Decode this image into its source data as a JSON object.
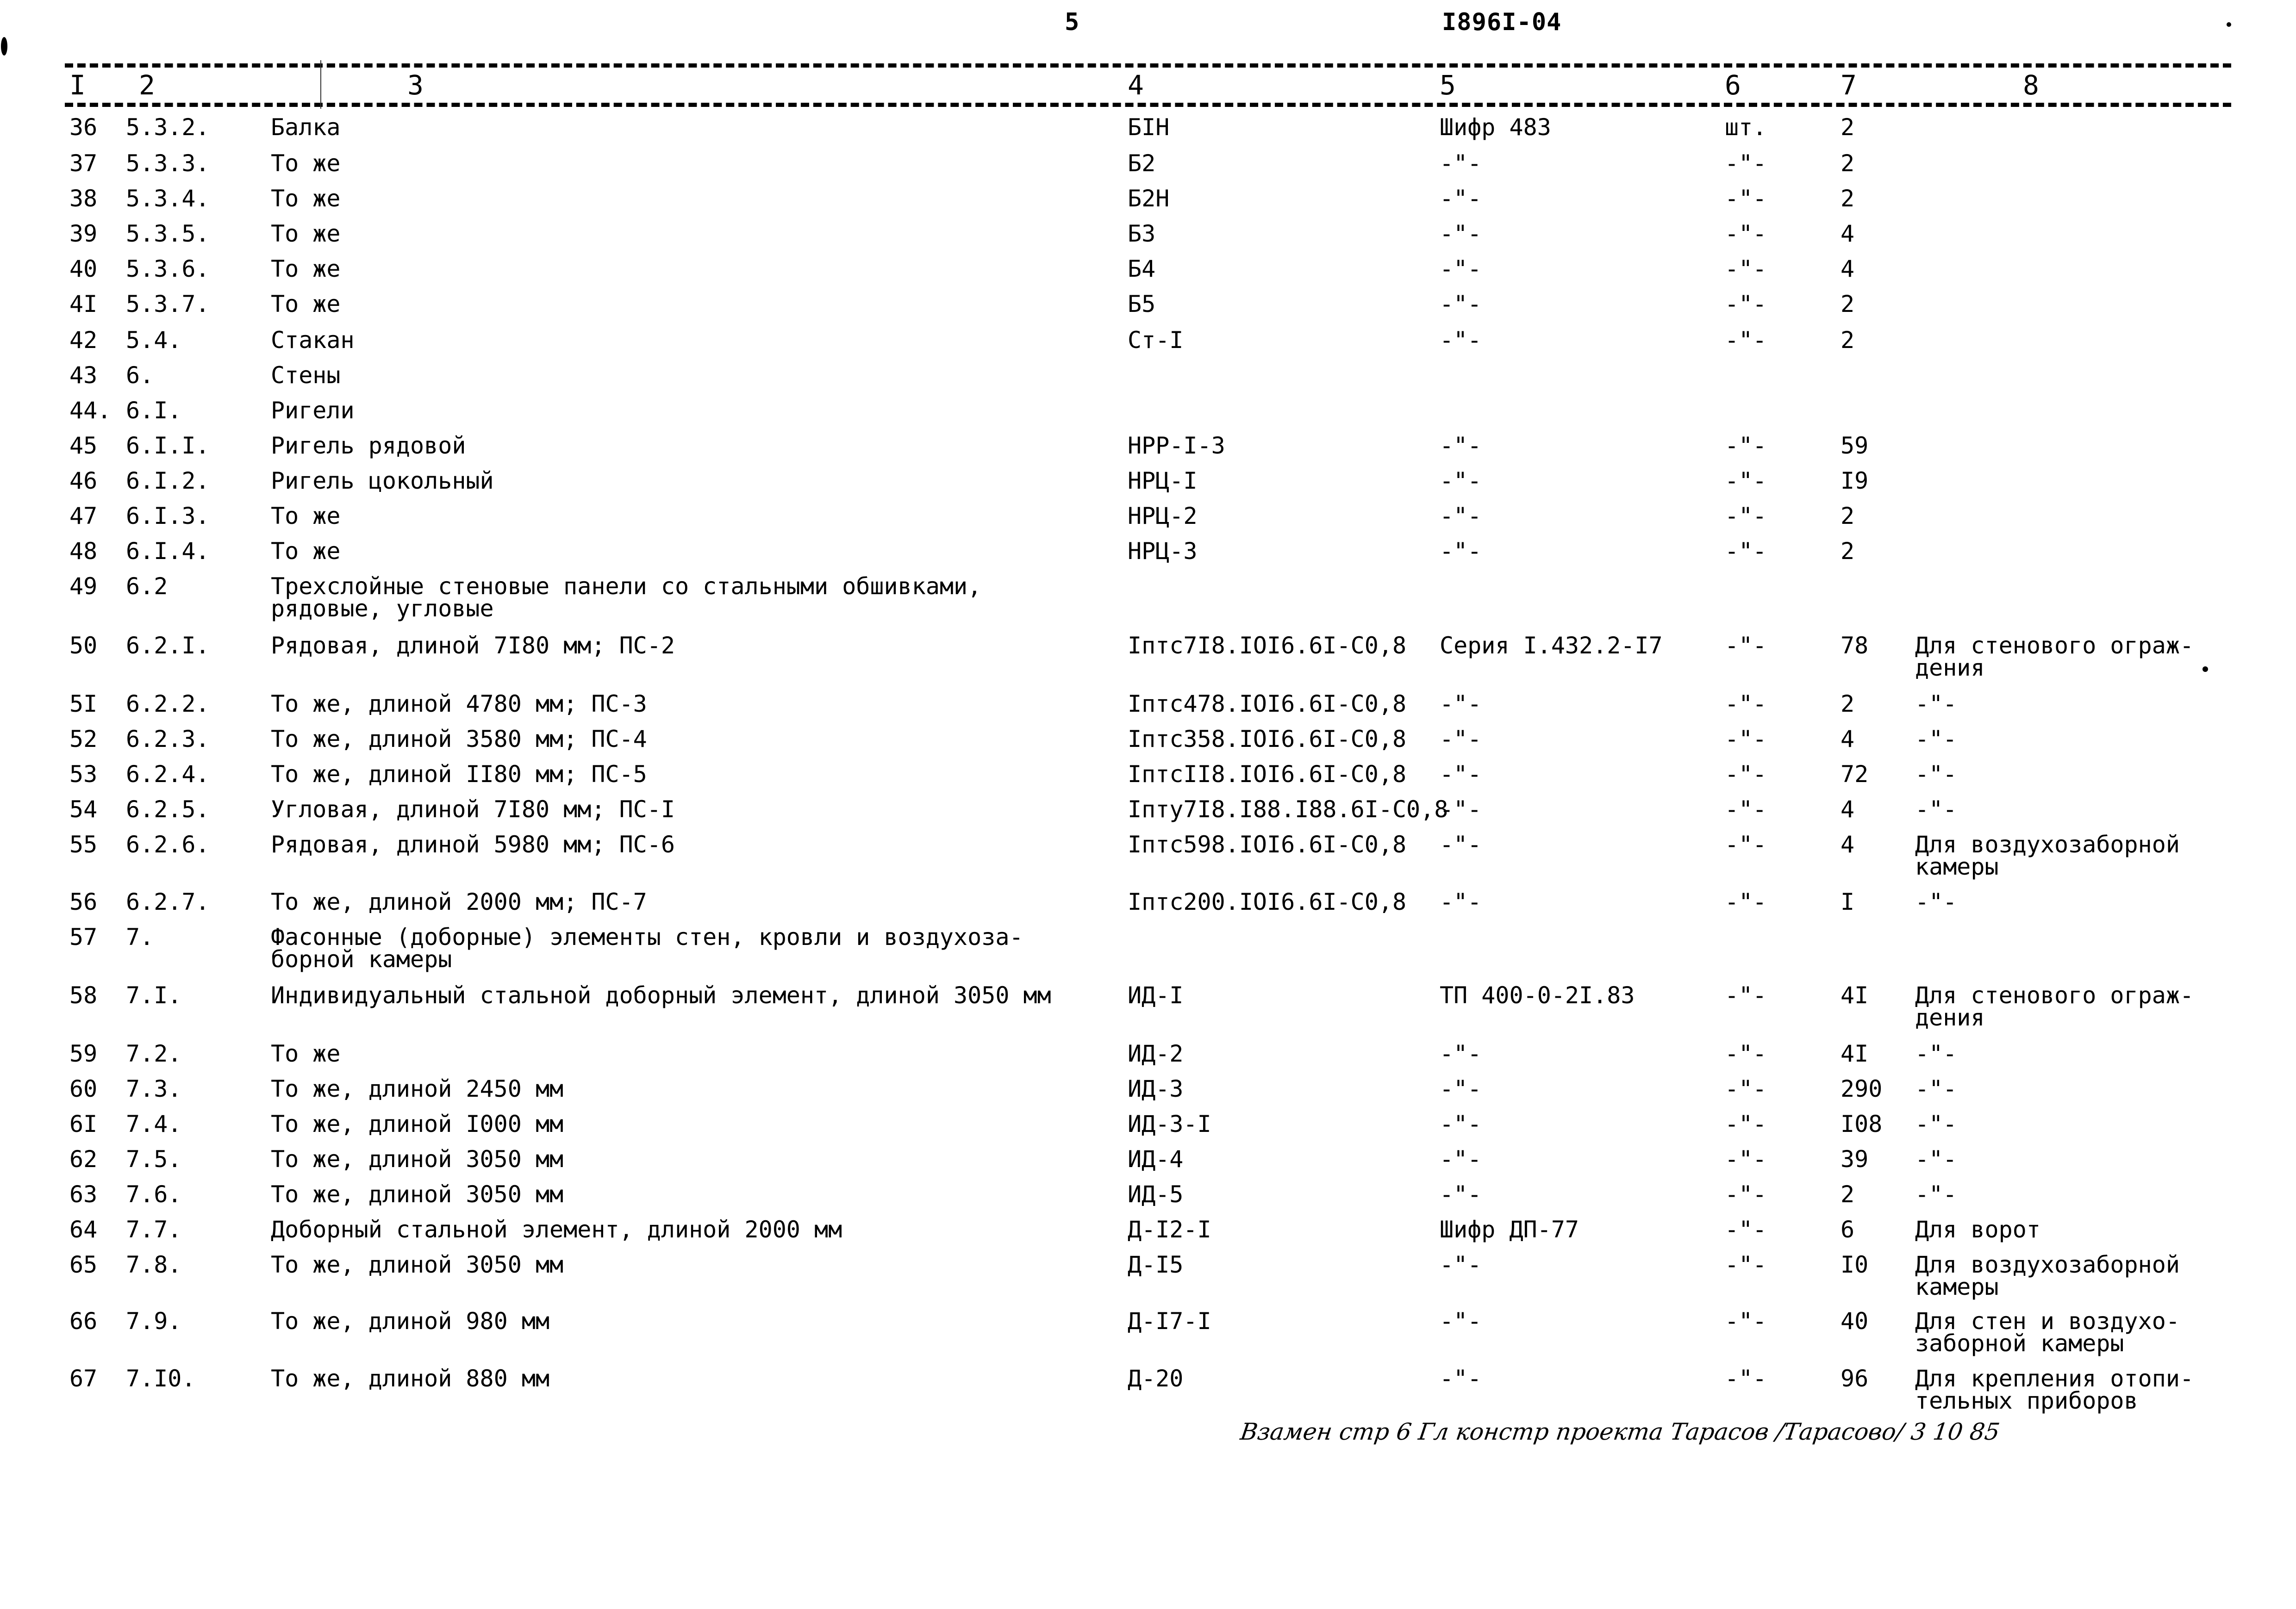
{
  "header": {
    "page_mark": "5",
    "doc_code": "I896I-04"
  },
  "columns": [
    "I",
    "2",
    "3",
    "4",
    "5",
    "6",
    "7",
    "8"
  ],
  "rows": [
    {
      "n": "36",
      "pos": "5.3.2.",
      "name": [
        "Балка"
      ],
      "mark": "БIН",
      "doc": "Шифр 483",
      "unit": "шт.",
      "qty": "2",
      "note": []
    },
    {
      "n": "37",
      "pos": "5.3.3.",
      "name": [
        "То же"
      ],
      "mark": "Б2",
      "doc": "-\"-",
      "unit": "-\"-",
      "qty": "2",
      "note": []
    },
    {
      "n": "38",
      "pos": "5.3.4.",
      "name": [
        "То же"
      ],
      "mark": "Б2Н",
      "doc": "-\"-",
      "unit": "-\"-",
      "qty": "2",
      "note": []
    },
    {
      "n": "39",
      "pos": "5.3.5.",
      "name": [
        "То же"
      ],
      "mark": "Б3",
      "doc": "-\"-",
      "unit": "-\"-",
      "qty": "4",
      "note": []
    },
    {
      "n": "40",
      "pos": "5.3.6.",
      "name": [
        "То же"
      ],
      "mark": "Б4",
      "doc": "-\"-",
      "unit": "-\"-",
      "qty": "4",
      "note": []
    },
    {
      "n": "4I",
      "pos": "5.3.7.",
      "name": [
        "То же"
      ],
      "mark": "Б5",
      "doc": "-\"-",
      "unit": "-\"-",
      "qty": "2",
      "note": []
    },
    {
      "n": "42",
      "pos": "5.4.",
      "name": [
        "Стакан"
      ],
      "mark": "Ст-I",
      "doc": "-\"-",
      "unit": "-\"-",
      "qty": "2",
      "note": []
    },
    {
      "n": "43",
      "pos": "6.",
      "name": [
        "Стены"
      ],
      "mark": "",
      "doc": "",
      "unit": "",
      "qty": "",
      "note": []
    },
    {
      "n": "44.",
      "pos": "6.I.",
      "name": [
        "Ригели"
      ],
      "mark": "",
      "doc": "",
      "unit": "",
      "qty": "",
      "note": []
    },
    {
      "n": "45",
      "pos": "6.I.I.",
      "name": [
        "Ригель рядовой"
      ],
      "mark": "НРР-I-3",
      "doc": "-\"-",
      "unit": "-\"-",
      "qty": "59",
      "note": []
    },
    {
      "n": "46",
      "pos": "6.I.2.",
      "name": [
        "Ригель цокольный"
      ],
      "mark": "НРЦ-I",
      "doc": "-\"-",
      "unit": "-\"-",
      "qty": "I9",
      "note": []
    },
    {
      "n": "47",
      "pos": "6.I.3.",
      "name": [
        "То же"
      ],
      "mark": "НРЦ-2",
      "doc": "-\"-",
      "unit": "-\"-",
      "qty": "2",
      "note": []
    },
    {
      "n": "48",
      "pos": "6.I.4.",
      "name": [
        "То же"
      ],
      "mark": "НРЦ-3",
      "doc": "-\"-",
      "unit": "-\"-",
      "qty": "2",
      "note": []
    },
    {
      "n": "49",
      "pos": "6.2",
      "name": [
        "Трехслойные стеновые панели со стальными обшивками,",
        "рядовые, угловые"
      ],
      "mark": "",
      "doc": "",
      "unit": "",
      "qty": "",
      "note": []
    },
    {
      "n": "50",
      "pos": "6.2.I.",
      "name": [
        "Рядовая, длиной 7I80 мм; ПС-2"
      ],
      "mark": "Iптс7I8.IOI6.6I-C0,8",
      "doc": "Серия I.432.2-I7",
      "unit": "-\"-",
      "qty": "78",
      "note": [
        "Для стенового ограж-",
        "дения"
      ]
    },
    {
      "n": "5I",
      "pos": "6.2.2.",
      "name": [
        "То же, длиной 4780 мм; ПС-3"
      ],
      "mark": "Iптс478.IOI6.6I-C0,8",
      "doc": "-\"-",
      "unit": "-\"-",
      "qty": "2",
      "note": [
        "-\"-"
      ]
    },
    {
      "n": "52",
      "pos": "6.2.3.",
      "name": [
        "То же, длиной 3580 мм; ПС-4"
      ],
      "mark": "Iптс358.IOI6.6I-C0,8",
      "doc": "-\"-",
      "unit": "-\"-",
      "qty": "4",
      "note": [
        "-\"-"
      ]
    },
    {
      "n": "53",
      "pos": "6.2.4.",
      "name": [
        "То же, длиной II80 мм; ПС-5"
      ],
      "mark": "IптсII8.IOI6.6I-C0,8",
      "doc": "-\"-",
      "unit": "-\"-",
      "qty": "72",
      "note": [
        "-\"-"
      ]
    },
    {
      "n": "54",
      "pos": "6.2.5.",
      "name": [
        "Угловая, длиной 7I80 мм; ПС-I"
      ],
      "mark": "Iпту7I8.I88.I88.6I-C0,8",
      "doc": "-\"-",
      "unit": "-\"-",
      "qty": "4",
      "note": [
        "-\"-"
      ]
    },
    {
      "n": "55",
      "pos": "6.2.6.",
      "name": [
        "Рядовая, длиной 5980 мм; ПС-6"
      ],
      "mark": "Iптс598.IOI6.6I-C0,8",
      "doc": "-\"-",
      "unit": "-\"-",
      "qty": "4",
      "note": [
        "Для воздухозаборной",
        "камеры"
      ]
    },
    {
      "n": "56",
      "pos": "6.2.7.",
      "name": [
        "То же, длиной 2000 мм; ПС-7"
      ],
      "mark": "Iптс200.IOI6.6I-C0,8",
      "doc": "-\"-",
      "unit": "-\"-",
      "qty": "I",
      "note": [
        "-\"-"
      ]
    },
    {
      "n": "57",
      "pos": "7.",
      "name": [
        "Фасонные (доборные) элементы стен, кровли и воздухоза-",
        "борной камеры"
      ],
      "mark": "",
      "doc": "",
      "unit": "",
      "qty": "",
      "note": []
    },
    {
      "n": "58",
      "pos": "7.I.",
      "name": [
        "Индивидуальный стальной доборный элемент, длиной 3050 мм"
      ],
      "mark": "ИД-I",
      "doc": "ТП 400-0-2I.83",
      "unit": "-\"-",
      "qty": "4I",
      "note": [
        "Для стенового ограж-",
        "дения"
      ]
    },
    {
      "n": "59",
      "pos": "7.2.",
      "name": [
        "То же"
      ],
      "mark": "ИД-2",
      "doc": "-\"-",
      "unit": "-\"-",
      "qty": "4I",
      "note": [
        "-\"-"
      ]
    },
    {
      "n": "60",
      "pos": "7.3.",
      "name": [
        "То же, длиной 2450 мм"
      ],
      "mark": "ИД-3",
      "doc": "-\"-",
      "unit": "-\"-",
      "qty": "290",
      "note": [
        "-\"-"
      ]
    },
    {
      "n": "6I",
      "pos": "7.4.",
      "name": [
        "То же, длиной I000 мм"
      ],
      "mark": "ИД-3-I",
      "doc": "-\"-",
      "unit": "-\"-",
      "qty": "I08",
      "note": [
        "-\"-"
      ]
    },
    {
      "n": "62",
      "pos": "7.5.",
      "name": [
        "То же, длиной 3050 мм"
      ],
      "mark": "ИД-4",
      "doc": "-\"-",
      "unit": "-\"-",
      "qty": "39",
      "note": [
        "-\"-"
      ]
    },
    {
      "n": "63",
      "pos": "7.6.",
      "name": [
        "То же, длиной 3050 мм"
      ],
      "mark": "ИД-5",
      "doc": "-\"-",
      "unit": "-\"-",
      "qty": "2",
      "note": [
        "-\"-"
      ]
    },
    {
      "n": "64",
      "pos": "7.7.",
      "name": [
        "Доборный стальной элемент, длиной 2000 мм"
      ],
      "mark": "Д-I2-I",
      "doc": "Шифр ДП-77",
      "unit": "-\"-",
      "qty": "6",
      "note": [
        "Для ворот"
      ]
    },
    {
      "n": "65",
      "pos": "7.8.",
      "name": [
        "То же, длиной 3050 мм"
      ],
      "mark": "Д-I5",
      "doc": "-\"-",
      "unit": "-\"-",
      "qty": "I0",
      "note": [
        "Для воздухозаборной",
        "камеры"
      ]
    },
    {
      "n": "66",
      "pos": "7.9.",
      "name": [
        "То же, длиной 980 мм"
      ],
      "mark": "Д-I7-I",
      "doc": "-\"-",
      "unit": "-\"-",
      "qty": "40",
      "note": [
        "Для стен и воздухо-",
        "заборной камеры"
      ]
    },
    {
      "n": "67",
      "pos": "7.I0.",
      "name": [
        "То же, длиной 880 мм"
      ],
      "mark": "Д-20",
      "doc": "-\"-",
      "unit": "-\"-",
      "qty": "96",
      "note": [
        "Для крепления отопи-",
        "тельных приборов"
      ]
    }
  ],
  "footnote": "Взамен стр 6   Гл констр проекта  Тарасов /Тарасово/   3 10 85"
}
